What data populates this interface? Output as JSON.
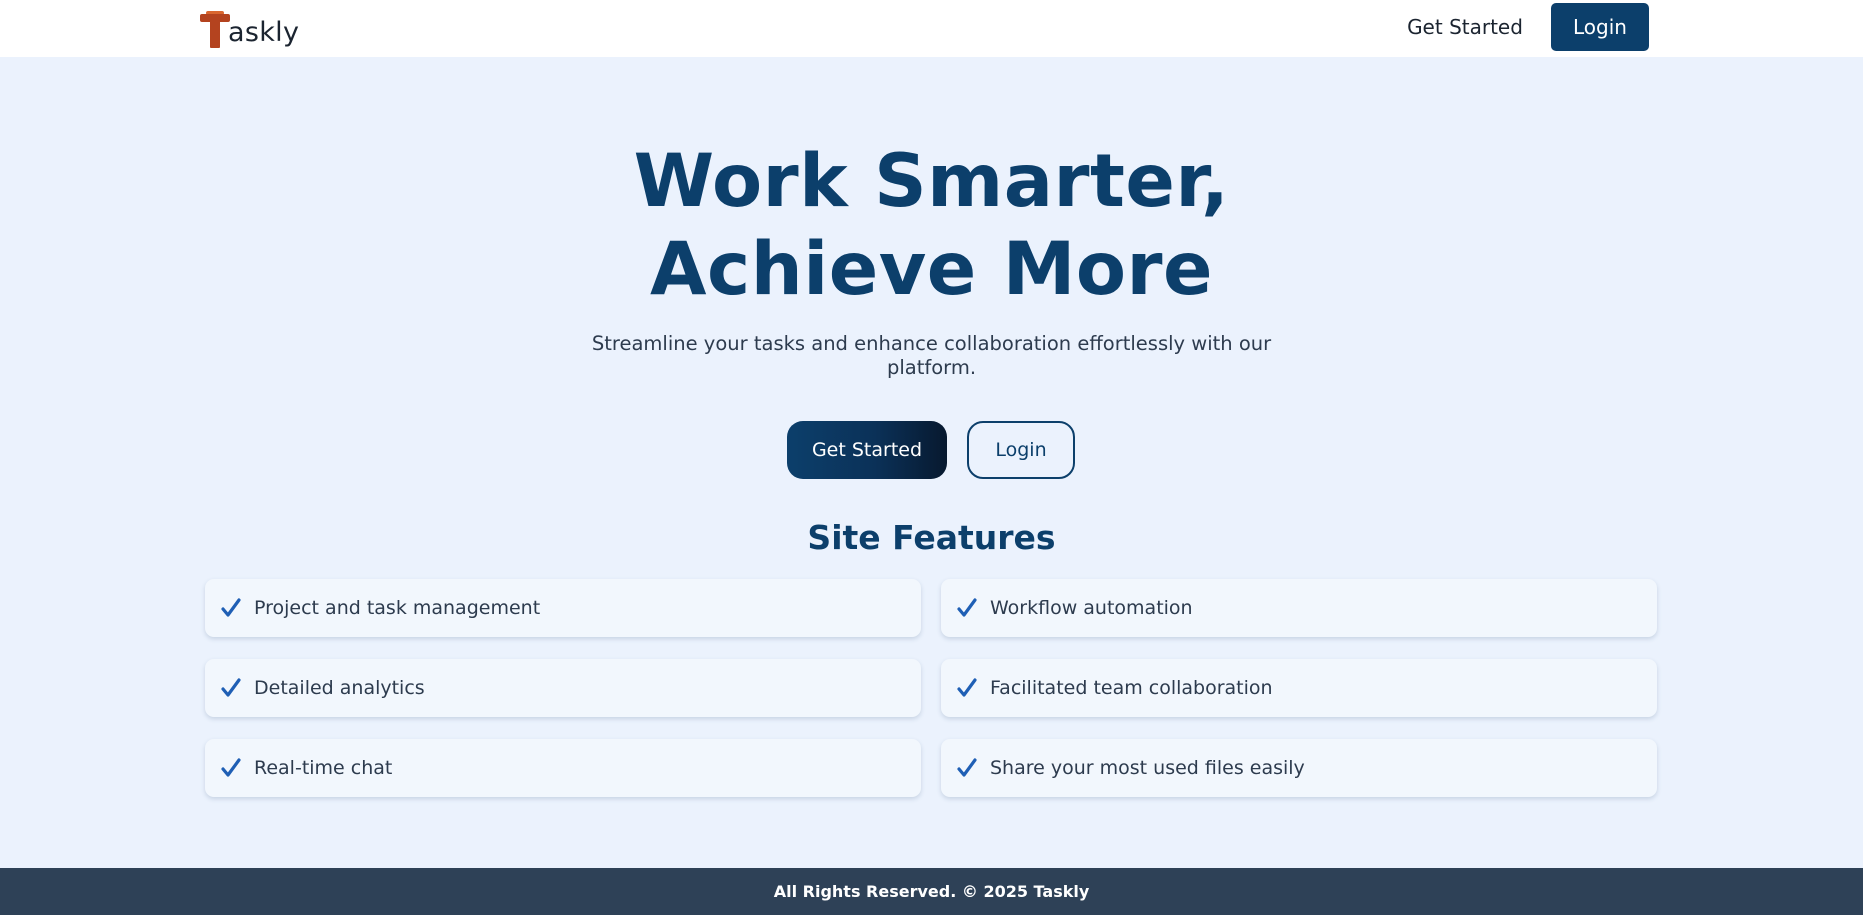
{
  "brand": {
    "logo_letter": "T",
    "name": "askly"
  },
  "nav": {
    "get_started_label": "Get Started",
    "login_label": "Login"
  },
  "hero": {
    "title_line1": "Work Smarter,",
    "title_line2": "Achieve More",
    "subtitle": "Streamline your tasks and enhance collaboration effortlessly with our platform.",
    "primary_button": "Get Started",
    "secondary_button": "Login"
  },
  "features": {
    "title": "Site Features",
    "check_icon": "check-icon",
    "items": [
      {
        "label": "Project and task management"
      },
      {
        "label": "Workflow automation"
      },
      {
        "label": "Detailed analytics"
      },
      {
        "label": "Facilitated team collaboration"
      },
      {
        "label": "Real-time chat"
      },
      {
        "label": "Share your most used files easily"
      }
    ]
  },
  "footer": {
    "text": "All Rights Reserved. © 2025 Taskly"
  },
  "colors": {
    "primary": "#0c3f6b",
    "background": "#ebf2fd",
    "footer": "#2e4157",
    "check": "#1f5fb5",
    "logo": "#b4431f"
  }
}
